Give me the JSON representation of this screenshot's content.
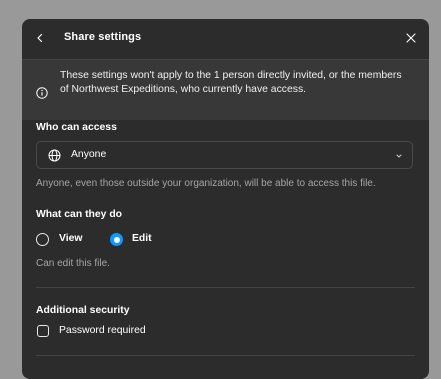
{
  "dialog": {
    "title": "Share settings",
    "back_icon": "chevron-left-icon",
    "close_icon": "close-icon"
  },
  "notice": {
    "icon": "info-icon",
    "line1": "These settings won't apply to the 1 person directly invited, or the members",
    "line2": "of Northwest Expeditions, who currently have access."
  },
  "access": {
    "label": "Who can access",
    "selected": "Anyone",
    "icon": "globe-icon",
    "helper": "Anyone, even those outside your organization, will be able to access this file."
  },
  "permissions": {
    "label": "What can they do",
    "options": [
      {
        "label": "View",
        "selected": false
      },
      {
        "label": "Edit",
        "selected": true
      }
    ],
    "helper": "Can edit this file."
  },
  "security": {
    "label": "Additional security",
    "password_label": "Password required",
    "password_checked": false
  },
  "colors": {
    "dialog_bg": "#2c2c2c",
    "notice_bg": "#383838",
    "accent": "#0d99ff",
    "helper_text": "#a6a6a6"
  }
}
